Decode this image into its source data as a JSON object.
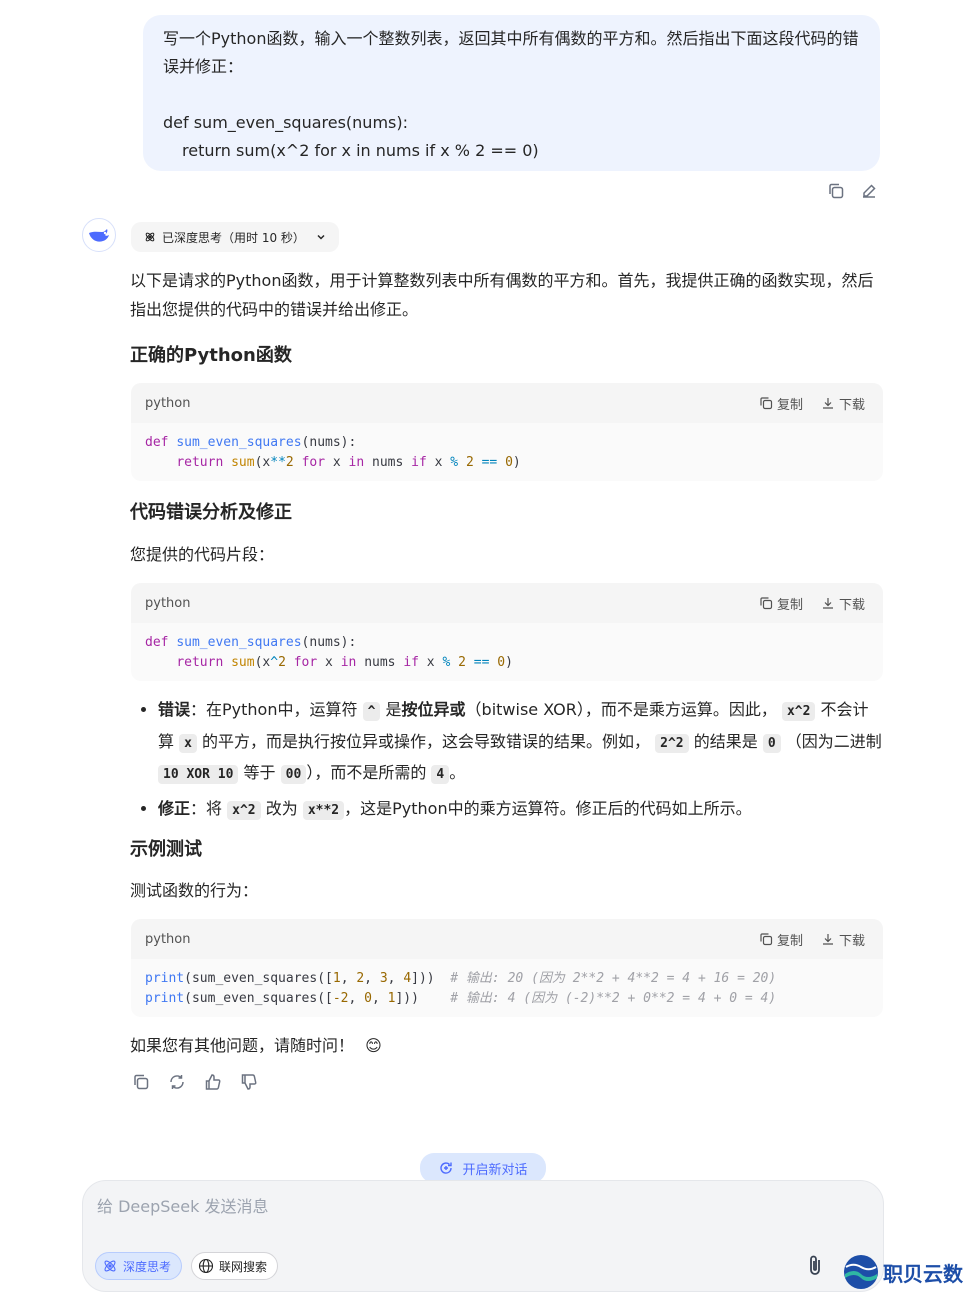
{
  "user_message": {
    "line1": "写一个Python函数，输入一个整数列表，返回其中所有偶数的平方和。然后指出下面这段代码的错",
    "line2": "误并修正：",
    "code_line1": "def sum_even_squares(nums):",
    "code_line2": "return sum(x^2 for x in nums if x % 2 == 0)"
  },
  "thinking": {
    "label": "已深度思考（用时 10 秒）"
  },
  "answer": {
    "intro_line1": "以下是请求的Python函数，用于计算整数列表中所有偶数的平方和。首先，我提供正确的函数实现，然后",
    "intro_line2": "指出您提供的代码中的错误并给出修正。",
    "heading1": "正确的Python函数",
    "heading2": "代码错误分析及修正",
    "snippet_intro": "您提供的代码片段：",
    "bullet1": {
      "label": "错误",
      "t1": "：在Python中，运算符",
      "code1": "^",
      "t2": "是",
      "bold1": "按位异或",
      "t3": "（bitwise XOR），而不是乘方运算。因此，",
      "code2": "x^2",
      "t4": "不会计",
      "t5": "算",
      "code3": "x",
      "t6": "的平方，而是执行按位异或操作，这会导致错误的结果。例如，",
      "code4": "2^2",
      "t7": "的结果是",
      "code5": "0",
      "t8": "（因为二进制",
      "code6": "10 XOR 10",
      "t9": "等于",
      "code7": "00",
      "t10": "），而不是所需的",
      "code8": "4",
      "t11": "。"
    },
    "bullet2": {
      "label": "修正",
      "t1": "：将",
      "code1": "x^2",
      "t2": "改为",
      "code2": "x**2",
      "t3": "，这是Python中的乘方运算符。修正后的代码如上所示。"
    },
    "heading3": "示例测试",
    "test_intro": "测试函数的行为：",
    "closing": "如果您有其他问题，请随时问！",
    "closing_emoji": "😊"
  },
  "code_blocks": [
    {
      "lang": "python",
      "copy": "复制",
      "download": "下载"
    },
    {
      "lang": "python",
      "copy": "复制",
      "download": "下载"
    },
    {
      "lang": "python",
      "copy": "复制",
      "download": "下载"
    }
  ],
  "code": {
    "b1_def": "def",
    "b1_name": "sum_even_squares",
    "b1_args": "(nums):",
    "b1_return": "return",
    "b1_sum": "sum",
    "b1_x": "(x",
    "b1_pow": "**",
    "b1_2": "2",
    "b1_for": "for",
    "b1_in": "in",
    "b1_nums": "nums",
    "b1_if": "if",
    "b1_mod": "%",
    "b1_eq": "==",
    "b1_zero": "0",
    "b2_xor": "^",
    "t_print": "print",
    "t_line1_args": "(sum_even_squares([",
    "t_line1_vals": [
      "1",
      "2",
      "3",
      "4"
    ],
    "t_line1_close": "]))",
    "t_line1_comment": "# 输出: 20 (因为 2**2 + 4**2 = 4 + 16 = 20)",
    "t_line2_args": "(sum_even_squares([",
    "t_line2_vals": [
      "-2",
      "0",
      "1"
    ],
    "t_line2_close": "]))",
    "t_line2_comment": "# 输出: 4 (因为 (-2)**2 + 0**2 = 4 + 0 = 4)"
  },
  "new_chat": {
    "label": "开启新对话"
  },
  "input": {
    "placeholder": "给 DeepSeek 发送消息",
    "deep_think": "深度思考",
    "web_search": "联网搜索"
  },
  "watermark": {
    "text": "职贝云数"
  },
  "colors": {
    "accent": "#4d6bfe",
    "user_bubble": "#eef3fe"
  }
}
